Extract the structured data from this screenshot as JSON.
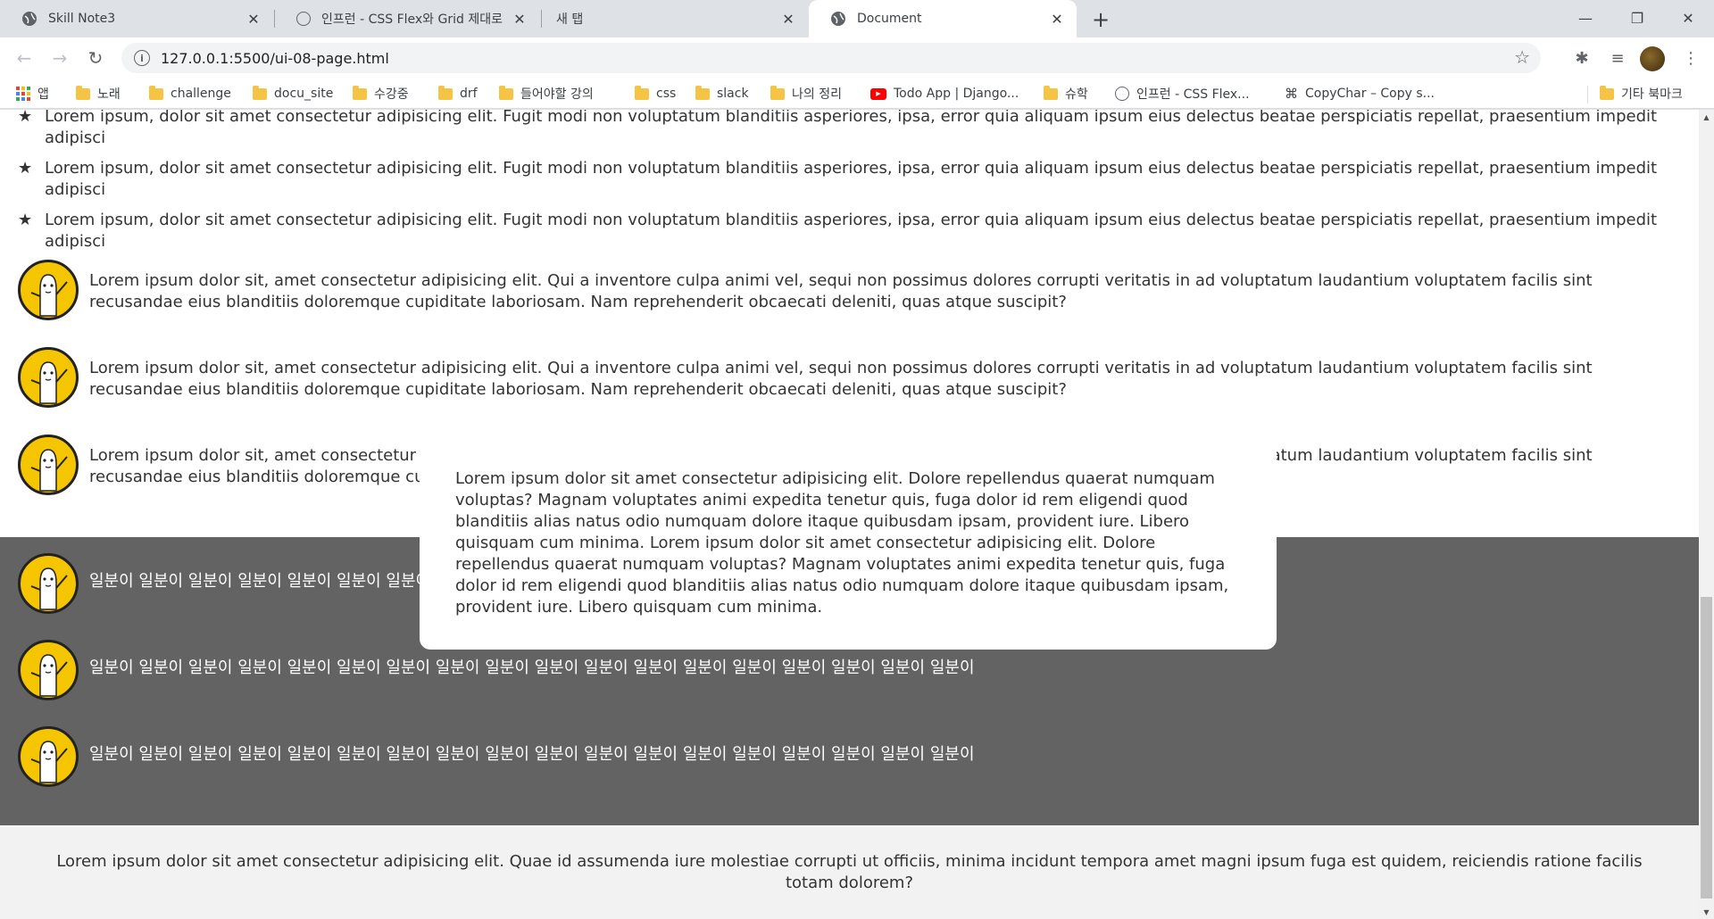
{
  "browser": {
    "tabs": [
      {
        "title": "Skill Note3",
        "icon": "globe-icon",
        "active": false
      },
      {
        "title": "인프런 - CSS Flex와 Grid 제대로",
        "icon": "inflearn-icon",
        "active": false
      },
      {
        "title": "새 탭",
        "icon": "",
        "active": false
      },
      {
        "title": "Document",
        "icon": "globe-icon",
        "active": true
      }
    ],
    "new_tab_symbol": "+",
    "url": "127.0.0.1:5500/ui-08-page.html",
    "bookmarks": [
      {
        "label": "앱",
        "type": "apps"
      },
      {
        "label": "노래",
        "type": "folder"
      },
      {
        "label": "challenge",
        "type": "folder"
      },
      {
        "label": "docu_site",
        "type": "folder"
      },
      {
        "label": "수강중",
        "type": "folder"
      },
      {
        "label": "drf",
        "type": "folder"
      },
      {
        "label": "들어야할 강의",
        "type": "folder"
      },
      {
        "label": "css",
        "type": "folder"
      },
      {
        "label": "slack",
        "type": "folder"
      },
      {
        "label": "나의 정리",
        "type": "folder"
      },
      {
        "label": "Todo App | Django...",
        "type": "youtube"
      },
      {
        "label": "슈학",
        "type": "folder"
      },
      {
        "label": "인프런 - CSS Flex...",
        "type": "site"
      },
      {
        "label": "CopyChar – Copy s...",
        "type": "cmd"
      },
      {
        "label": "기타 북마크",
        "type": "folder"
      }
    ]
  },
  "page": {
    "star_items": [
      {
        "text": "Lorem ipsum, dolor sit amet consectetur adipisicing elit. Fugit modi non voluptatum blanditiis asperiores, ipsa, error quia aliquam ipsum eius delectus beatae perspiciatis repellat, praesentium impedit adipisci"
      },
      {
        "text": "Lorem ipsum, dolor sit amet consectetur adipisicing elit. Fugit modi non voluptatum blanditiis asperiores, ipsa, error quia aliquam ipsum eius delectus beatae perspiciatis repellat, praesentium impedit adipisci"
      },
      {
        "text": "Lorem ipsum, dolor sit amet consectetur adipisicing elit. Fugit modi non voluptatum blanditiis asperiores, ipsa, error quia aliquam ipsum eius delectus beatae perspiciatis repellat, praesentium impedit adipisci"
      }
    ],
    "media_items": [
      {
        "text": "Lorem ipsum dolor sit, amet consectetur adipisicing elit. Qui a inventore culpa animi vel, sequi non possimus dolores corrupti veritatis in ad voluptatum laudantium voluptatem facilis sint recusandae eius blanditiis doloremque cupiditate laboriosam. Nam reprehenderit obcaecati deleniti, quas atque suscipit?"
      },
      {
        "text": "Lorem ipsum dolor sit, amet consectetur adipisicing elit. Qui a inventore culpa animi vel, sequi non possimus dolores corrupti veritatis in ad voluptatum laudantium voluptatem facilis sint recusandae eius blanditiis doloremque cupiditate laboriosam. Nam reprehenderit obcaecati deleniti, quas atque suscipit?"
      },
      {
        "text": "Lorem ipsum dolor sit, amet consectetur adipisicing elit. Qui a inventore culpa animi vel, sequi non possimus dolores corrupti veritatis in ad voluptatum laudantium voluptatem facilis sint recusandae eius blanditiis doloremque cupiditate laboriosam. Nam reprehenderit obcaecati deleniti, quas atque suscipit?"
      }
    ],
    "dark_items": [
      {
        "text": "일분이 일분이 일분이 일분이 일분이 일분이 일분이 일분이 일분이 일분이 일분이 일분이 일분이 일분이 일분이 일분이 일분이 일분이"
      },
      {
        "text": "일분이 일분이 일분이 일분이 일분이 일분이 일분이 일분이 일분이 일분이 일분이 일분이 일분이 일분이 일분이 일분이 일분이 일분이"
      },
      {
        "text": "일분이 일분이 일분이 일분이 일분이 일분이 일분이 일분이 일분이 일분이 일분이 일분이 일분이 일분이 일분이 일분이 일분이 일분이"
      }
    ],
    "modal_text": "Lorem ipsum dolor sit amet consectetur adipisicing elit. Dolore repellendus quaerat numquam voluptas? Magnam voluptates animi expedita tenetur quis, fuga dolor id rem eligendi quod blanditiis alias natus odio numquam dolore itaque quibusdam ipsam, provident iure. Libero quisquam cum minima. Lorem ipsum dolor sit amet consectetur adipisicing elit. Dolore repellendus quaerat numquam voluptas? Magnam voluptates animi expedita tenetur quis, fuga dolor id rem eligendi quod blanditiis alias natus odio numquam dolore itaque quibusdam ipsam, provident iure. Libero quisquam cum minima.",
    "footer_text": "Lorem ipsum dolor sit amet consectetur adipisicing elit. Quae id assumenda iure molestiae corrupti ut officiis, minima incidunt tempora amet magni ipsum fuga est quidem, reiciendis ratione facilis totam dolorem?",
    "colors": {
      "dark_section": "#636363",
      "avatar_yellow": "#f5c500",
      "footer_bg": "#f2f2f2"
    }
  }
}
